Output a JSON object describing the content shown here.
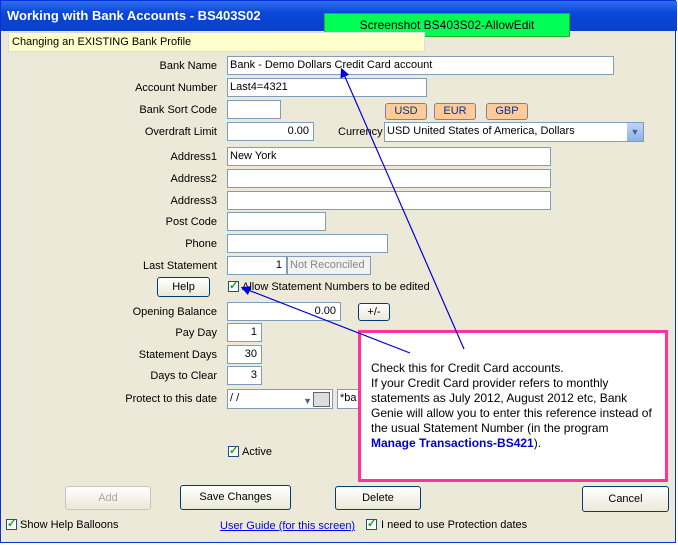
{
  "window": {
    "title": "Working with Bank Accounts - BS403S02",
    "banner": "Screenshot BS403S02-AllowEdit",
    "mode_text": "Changing an EXISTING Bank Profile"
  },
  "form": {
    "bank_name_label": "Bank Name",
    "bank_name_value": "Bank - Demo Dollars Credit Card account",
    "account_number_label": "Account Number",
    "account_number_value": "Last4=4321",
    "sort_code_label": "Bank Sort Code",
    "sort_code_value": "",
    "overdraft_label": "Overdraft Limit",
    "overdraft_value": "0.00",
    "currency_label": "Currency",
    "currency_value": "USD United States of America, Dollars",
    "currency_buttons": [
      "USD",
      "EUR",
      "GBP"
    ],
    "address1_label": "Address1",
    "address1_value": "New York",
    "address2_label": "Address2",
    "address2_value": "",
    "address3_label": "Address3",
    "address3_value": "",
    "postcode_label": "Post Code",
    "postcode_value": "",
    "phone_label": "Phone",
    "phone_value": "",
    "last_statement_label": "Last Statement",
    "last_statement_value": "1",
    "not_reconciled": "Not Reconciled",
    "help_label": "Help",
    "allow_edit_label": "Allow Statement Numbers to be edited",
    "opening_balance_label": "Opening Balance",
    "opening_balance_value": "0.00",
    "plusminus_label": "+/-",
    "pay_day_label": "Pay Day",
    "pay_day_value": "1",
    "statement_days_label": "Statement Days",
    "statement_days_value": "30",
    "days_to_clear_label": "Days to Clear",
    "days_to_clear_value": "3",
    "protect_label": "Protect to this date",
    "protect_value": " /  /",
    "protect_extra": "*ba",
    "active_label": "Active"
  },
  "popup": {
    "line1": "Check this for Credit Card accounts.",
    "line2": "If your Credit Card provider refers to monthly statements as July 2012, August 2012 etc, Bank Genie will allow you to enter this reference instead of the usual Statement Number (in the program ",
    "link": "Manage Transactions-BS421",
    "tail": ")."
  },
  "footer": {
    "add_label": "Add",
    "save_label": "Save Changes",
    "delete_label": "Delete",
    "cancel_label": "Cancel",
    "show_help_label": "Show Help Balloons",
    "user_guide_label": "User Guide (for this screen)",
    "protection_label": "I need to use Protection dates"
  },
  "colors": {
    "accent": "#0a46d8",
    "popup_border": "#ff3399",
    "banner": "#00ff55",
    "currency_btn": "#ffcc99"
  }
}
